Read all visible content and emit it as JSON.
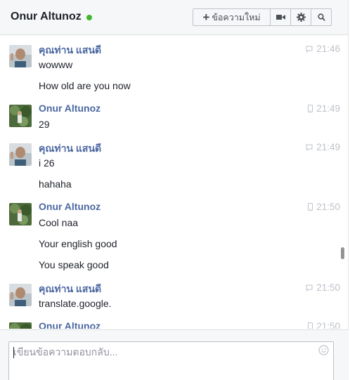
{
  "header": {
    "title": "Onur Altunoz",
    "status": "online",
    "new_message_label": "ข้อความใหม่",
    "icons": [
      "video-call-icon",
      "gear-icon",
      "search-icon"
    ]
  },
  "messages": [
    {
      "sender": "คุณท่าน แสนดี",
      "time": "21:46",
      "device": "web",
      "texts": [
        "wowww",
        "How old are you now"
      ]
    },
    {
      "sender": "Onur Altunoz",
      "time": "21:49",
      "device": "mobile",
      "texts": [
        "29"
      ]
    },
    {
      "sender": "คุณท่าน แสนดี",
      "time": "21:49",
      "device": "web",
      "texts": [
        "i 26",
        "hahaha"
      ]
    },
    {
      "sender": "Onur Altunoz",
      "time": "21:50",
      "device": "mobile",
      "texts": [
        "Cool naa",
        "Your english good",
        "You speak good"
      ]
    },
    {
      "sender": "คุณท่าน แสนดี",
      "time": "21:50",
      "device": "web",
      "texts": [
        "translate.google."
      ]
    },
    {
      "sender": "Onur Altunoz",
      "time": "21:50",
      "device": "mobile",
      "texts": []
    }
  ],
  "composer": {
    "placeholder": "เขียนข้อความตอบกลับ..."
  },
  "colors": {
    "sender_name": "#4b67a1",
    "online": "#42b72a",
    "timestamp": "#bec2c9"
  }
}
